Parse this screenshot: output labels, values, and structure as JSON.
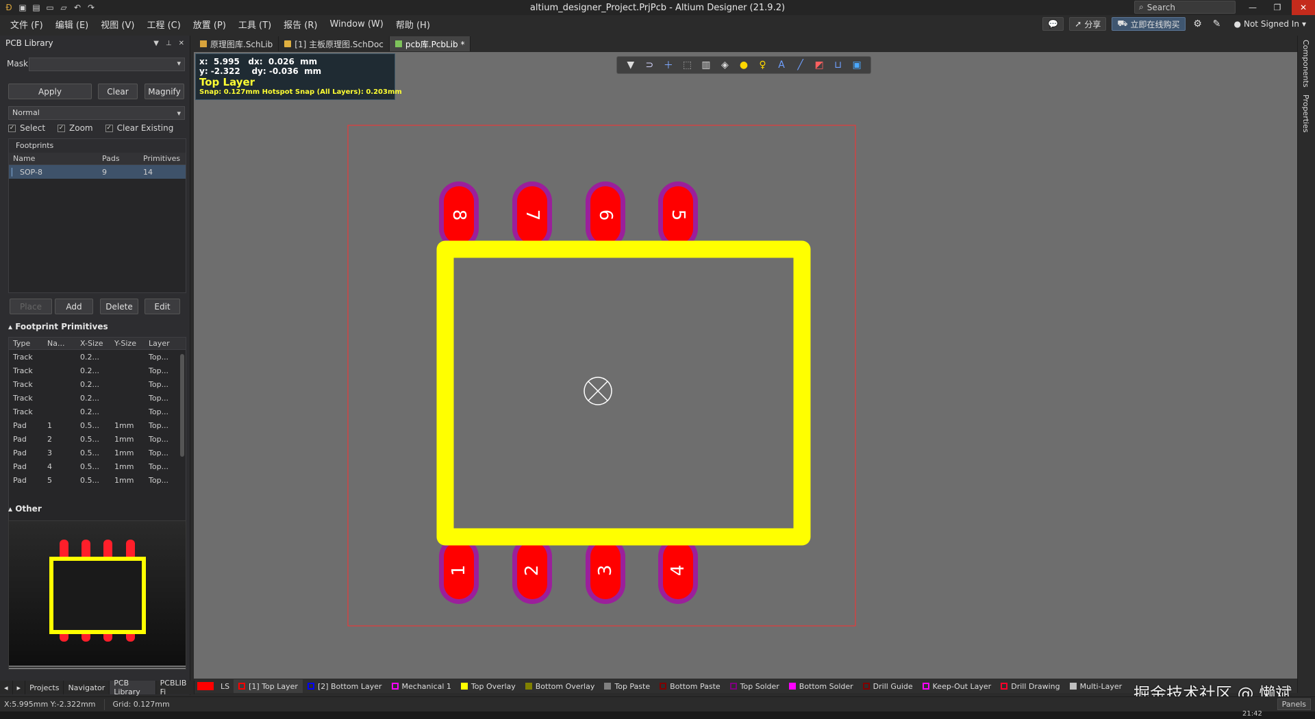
{
  "window": {
    "title": "altium_designer_Project.PrjPcb - Altium Designer (21.9.2)",
    "search_placeholder": "Search"
  },
  "menu": {
    "items": [
      "文件 (F)",
      "编辑 (E)",
      "视图 (V)",
      "工程 (C)",
      "放置 (P)",
      "工具 (T)",
      "报告 (R)",
      "Window (W)",
      "帮助 (H)"
    ],
    "share": "分享",
    "buy": "立即在线购买",
    "signin": "Not Signed In"
  },
  "panel": {
    "title": "PCB Library",
    "mask_label": "Mask",
    "mask_value": "",
    "apply": "Apply",
    "clear": "Clear",
    "magnify": "Magnify",
    "mode": "Normal",
    "select": "Select",
    "zoom": "Zoom",
    "clear_existing": "Clear Existing",
    "footprints_label": "Footprints",
    "fp_cols": [
      "Name",
      "Pads",
      "Primitives"
    ],
    "fp_rows": [
      {
        "name": "SOP-8",
        "pads": "9",
        "primitives": "14"
      }
    ],
    "place": "Place",
    "add": "Add",
    "delete": "Delete",
    "edit": "Edit",
    "primitives_label": "Footprint Primitives",
    "prim_cols": [
      "Type",
      "Na...",
      "X-Size",
      "Y-Size",
      "Layer"
    ],
    "prim_rows": [
      {
        "type": "Track",
        "name": "",
        "x": "0.2...",
        "y": "",
        "layer": "Top..."
      },
      {
        "type": "Track",
        "name": "",
        "x": "0.2...",
        "y": "",
        "layer": "Top..."
      },
      {
        "type": "Track",
        "name": "",
        "x": "0.2...",
        "y": "",
        "layer": "Top..."
      },
      {
        "type": "Track",
        "name": "",
        "x": "0.2...",
        "y": "",
        "layer": "Top..."
      },
      {
        "type": "Track",
        "name": "",
        "x": "0.2...",
        "y": "",
        "layer": "Top..."
      },
      {
        "type": "Pad",
        "name": "1",
        "x": "0.5...",
        "y": "1mm",
        "layer": "Top..."
      },
      {
        "type": "Pad",
        "name": "2",
        "x": "0.5...",
        "y": "1mm",
        "layer": "Top..."
      },
      {
        "type": "Pad",
        "name": "3",
        "x": "0.5...",
        "y": "1mm",
        "layer": "Top..."
      },
      {
        "type": "Pad",
        "name": "4",
        "x": "0.5...",
        "y": "1mm",
        "layer": "Top..."
      },
      {
        "type": "Pad",
        "name": "5",
        "x": "0.5...",
        "y": "1mm",
        "layer": "Top..."
      }
    ],
    "other_label": "Other"
  },
  "panel_tabs": [
    "Projects",
    "Navigator",
    "PCB Library",
    "PCBLIB Fi"
  ],
  "doc_tabs": [
    {
      "label": "原理图库.SchLib",
      "kind": "schlib"
    },
    {
      "label": "[1] 主板原理图.SchDoc",
      "kind": "sch"
    },
    {
      "label": "pcb库.PcbLib *",
      "kind": "pcb"
    }
  ],
  "hud": {
    "line1": "x:  5.995   dx:  0.026  mm",
    "line2": "y: -2.322    dy: -0.036  mm",
    "layer": "Top Layer",
    "snap": "Snap: 0.127mm Hotspot Snap (All Layers): 0.203mm"
  },
  "footprint": {
    "pins_top": [
      "8",
      "7",
      "6",
      "5"
    ],
    "pins_bottom": [
      "1",
      "2",
      "3",
      "4"
    ],
    "overlay_color": "#ffff00",
    "pad_color": "#ff0000",
    "solder_color": "#9b1f9b",
    "outline_color": "#ff3030"
  },
  "layers": {
    "ls": "LS",
    "items": [
      {
        "label": "[1] Top Layer",
        "color": "#ff0000",
        "active": true
      },
      {
        "label": "[2] Bottom Layer",
        "color": "#0000ff"
      },
      {
        "label": "Mechanical 1",
        "color": "#ff00ff"
      },
      {
        "label": "Top Overlay",
        "color": "#ffff00"
      },
      {
        "label": "Bottom Overlay",
        "color": "#808000"
      },
      {
        "label": "Top Paste",
        "color": "#808080"
      },
      {
        "label": "Bottom Paste",
        "color": "#800000"
      },
      {
        "label": "Top Solder",
        "color": "#800080"
      },
      {
        "label": "Bottom Solder",
        "color": "#ff00ff"
      },
      {
        "label": "Drill Guide",
        "color": "#800000"
      },
      {
        "label": "Keep-Out Layer",
        "color": "#ff00ff"
      },
      {
        "label": "Drill Drawing",
        "color": "#ff002a"
      },
      {
        "label": "Multi-Layer",
        "color": "#c0c0c0"
      }
    ]
  },
  "rightrail": [
    "Components",
    "Properties"
  ],
  "watermark": "掘金技术社区 @ 懒斌",
  "status": {
    "coords": "X:5.995mm Y:-2.322mm",
    "grid": "Grid: 0.127mm",
    "panels": "Panels",
    "clock": "21:42"
  }
}
